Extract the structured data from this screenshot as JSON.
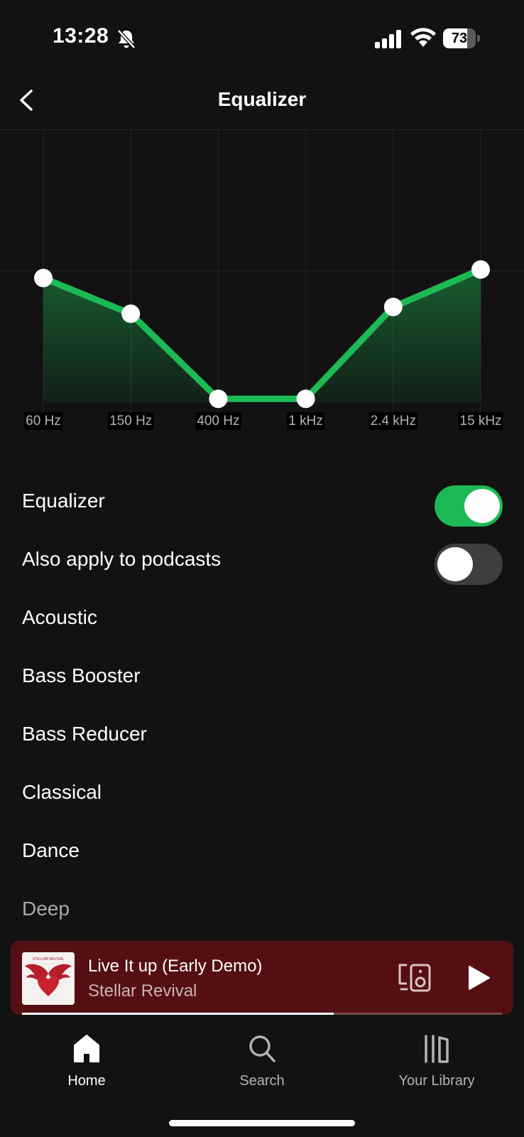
{
  "status_bar": {
    "time": "13:28",
    "battery_level": "73",
    "battery_fraction": 0.73,
    "icons": [
      "bell-slash-icon",
      "cellular-signal-icon",
      "wifi-icon",
      "battery-icon"
    ]
  },
  "header": {
    "title": "Equalizer",
    "back_icon": "chevron-left-icon"
  },
  "chart_data": {
    "type": "line",
    "categories": [
      "60 Hz",
      "150 Hz",
      "400 Hz",
      "1 kHz",
      "2.4 kHz",
      "15 kHz"
    ],
    "values": [
      3.3,
      1.2,
      -3.8,
      -3.8,
      1.6,
      3.8
    ],
    "ylim": [
      -4,
      12
    ],
    "grid": true,
    "line_color": "#1db954",
    "fill_color": "#1db954",
    "point_color": "#ffffff"
  },
  "settings": {
    "equalizer_label": "Equalizer",
    "equalizer_on": true,
    "podcasts_label": "Also apply to podcasts",
    "podcasts_on": false,
    "toggle_on_color": "#1db954",
    "toggle_off_color": "#3e3e3e"
  },
  "presets": [
    "Acoustic",
    "Bass Booster",
    "Bass Reducer",
    "Classical",
    "Dance",
    "Deep"
  ],
  "now_playing": {
    "title": "Live It up (Early Demo)",
    "artist": "Stellar Revival",
    "album_art_text": "STELLAR REVIVAL",
    "progress": 0.65,
    "background_color": "#550f13",
    "connect_icon": "connect-device-icon",
    "play_icon": "play-icon"
  },
  "nav": {
    "items": [
      {
        "label": "Home",
        "icon": "home-icon",
        "active": true
      },
      {
        "label": "Search",
        "icon": "search-icon",
        "active": false
      },
      {
        "label": "Your Library",
        "icon": "library-icon",
        "active": false
      }
    ]
  }
}
